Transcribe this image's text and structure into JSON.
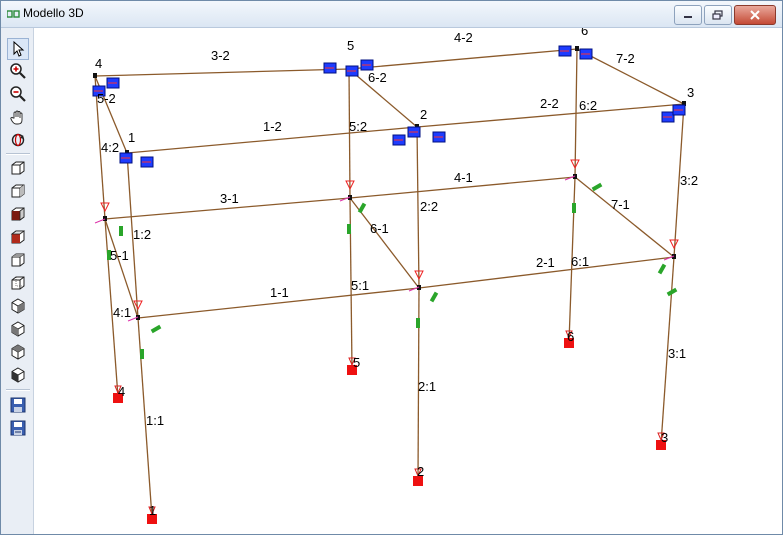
{
  "window": {
    "title": "Modello 3D"
  },
  "toolbar": {
    "tools": [
      "select-arrow-icon",
      "zoom-in-icon",
      "zoom-out-icon",
      "pan-hand-icon",
      "rotate-icon",
      "view-cube-1-icon",
      "view-cube-2-icon",
      "view-cube-3-icon",
      "view-cube-4-icon",
      "view-cube-5-icon",
      "view-cube-6-icon",
      "view-iso-1-icon",
      "view-iso-2-icon",
      "view-iso-3-icon",
      "view-iso-4-icon",
      "save-icon",
      "save-as-icon"
    ]
  },
  "model": {
    "node_labels": {
      "n4": "4",
      "n5": "5",
      "n6": "6",
      "n1": "1",
      "n2": "2",
      "n3": "3",
      "b4": "4",
      "b5": "5",
      "b6": "6",
      "b1": "1",
      "b2": "2",
      "b3": "3"
    },
    "beam_labels": {
      "b32": "3-2",
      "b42": "4-2",
      "b52": "5-2",
      "b62": "6-2",
      "b72": "7-2",
      "b12": "1-2",
      "b22": "2-2",
      "b31": "3-1",
      "b41": "4-1",
      "b51": "5-1",
      "b61": "6-1",
      "b71": "7-1",
      "b11": "1-1",
      "b21": "2-1"
    },
    "column_labels": {
      "c42": "4:2",
      "c52": "5:2",
      "c62": "6:2",
      "c12": "1:2",
      "c22": "2:2",
      "c32": "3:2",
      "c41": "4:1",
      "c51": "5:1",
      "c61": "6:1",
      "c11": "1:1",
      "c21": "2:1",
      "c31": "3:1"
    }
  }
}
